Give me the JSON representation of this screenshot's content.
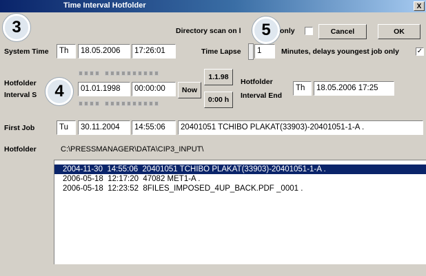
{
  "window": {
    "title": "Time Interval Hotfolder",
    "close_label": "X"
  },
  "callouts": {
    "c3": "3",
    "c4": "4",
    "c5": "5"
  },
  "scan": {
    "label": "Directory scan on l",
    "label_tail": "only",
    "checked": false
  },
  "buttons": {
    "cancel": "Cancel",
    "ok": "OK",
    "now": "Now",
    "date_preset": "1.1.98",
    "time_preset": "0:00 h"
  },
  "system_time": {
    "label": "System Time",
    "day": "Th",
    "date": "18.05.2006",
    "time": "17:26:01"
  },
  "time_lapse": {
    "label": "Time Lapse",
    "value": "1",
    "desc": "Minutes, delays youngest job only",
    "checked": true,
    "check_mark": "✓"
  },
  "interval_start": {
    "label1": "Hotfolder",
    "label2": "Interval S",
    "date": "01.01.1998",
    "time": "00:00:00"
  },
  "interval_end": {
    "label1": "Hotfolder",
    "label2": "Interval End",
    "day": "Th",
    "datetime": "18.05.2006 17:25"
  },
  "first_job": {
    "label": "First Job",
    "day": "Tu",
    "date": "30.11.2004",
    "time": "14:55:06",
    "name": "20401051 TCHIBO PLAKAT(33903)-20401051-1-A ."
  },
  "hotfolder": {
    "label": "Hotfolder",
    "path": "C:\\PRESSMANAGER\\DATA\\CIP3_INPUT\\"
  },
  "jobs": [
    {
      "date": "2004-11-30",
      "time": "14:55:06",
      "name": "20401051 TCHIBO PLAKAT(33903)-20401051-1-A ."
    },
    {
      "date": "2006-05-18",
      "time": "12:17:20",
      "name": "47082 MET1-A ."
    },
    {
      "date": "2006-05-18",
      "time": "12:23:52",
      "name": "8FILES_IMPOSED_4UP_BACK.PDF _0001 ."
    }
  ]
}
